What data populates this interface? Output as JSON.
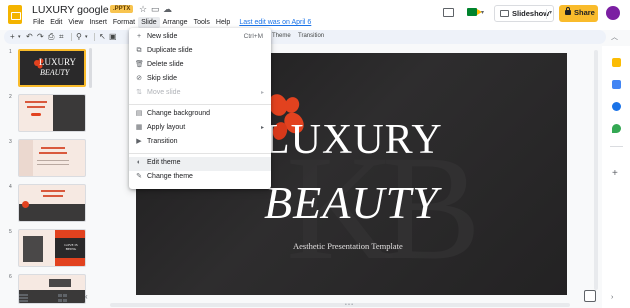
{
  "header": {
    "title": "LUXURY google slide",
    "format_badge": ".PPTX",
    "last_edit": "Last edit was on April 6",
    "slideshow_label": "Slideshow",
    "share_label": "Share"
  },
  "menubar": [
    "File",
    "Edit",
    "View",
    "Insert",
    "Format",
    "Slide",
    "Arrange",
    "Tools",
    "Help"
  ],
  "toolbar": {
    "items": [
      "Theme",
      "Transition"
    ]
  },
  "slide_menu": {
    "items": [
      {
        "label": "New slide",
        "shortcut": "Ctrl+M",
        "icon": "plus-icon"
      },
      {
        "label": "Duplicate slide",
        "icon": "duplicate-icon"
      },
      {
        "label": "Delete slide",
        "icon": "trash-icon"
      },
      {
        "label": "Skip slide",
        "icon": "eye-slash-icon"
      },
      {
        "label": "Move slide",
        "icon": "move-icon",
        "disabled": true,
        "submenu": true
      },
      {
        "label": "Change background",
        "icon": "background-icon"
      },
      {
        "label": "Apply layout",
        "icon": "layout-icon",
        "submenu": true
      },
      {
        "label": "Transition",
        "icon": "transition-icon"
      },
      {
        "label": "Edit theme",
        "icon": "palette-icon",
        "hovered": true
      },
      {
        "label": "Change theme",
        "icon": "paint-icon"
      }
    ]
  },
  "filmstrip": {
    "slides": [
      {
        "number": "1",
        "selected": true
      },
      {
        "number": "2"
      },
      {
        "number": "3"
      },
      {
        "number": "4"
      },
      {
        "number": "5"
      },
      {
        "number": "6"
      }
    ]
  },
  "slide": {
    "title_line1": "LUXURY",
    "title_line2": "BEAUTY",
    "subtitle": "Aesthetic Presentation Template"
  },
  "thumbs": {
    "t1_line1": "LUXURY",
    "t1_line2": "BEAUTY",
    "t5_text": "LOVE IS BEING"
  },
  "colors": {
    "accent_yellow": "#f9bb2b",
    "slide_bg": "#272627",
    "flower_red": "#e2421f",
    "thumb_peach": "#f6e9e2"
  }
}
